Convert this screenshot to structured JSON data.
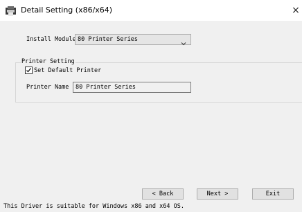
{
  "window": {
    "title": "Detail Setting (x86/x64)",
    "close_glyph": "×",
    "icon": "printer-app-icon"
  },
  "install": {
    "label": "Install Module",
    "selected": "80 Printer Series"
  },
  "printer_setting": {
    "group_title": "Printer Setting",
    "default_checkbox_label": "Set Default Printer",
    "default_checked": true,
    "name_label": "Printer Name",
    "name_value": "80 Printer Series"
  },
  "buttons": {
    "back": "< Back",
    "next": "Next >",
    "exit": "Exit"
  },
  "status_text": "This Driver is suitable for Windows x86 and x64 OS."
}
